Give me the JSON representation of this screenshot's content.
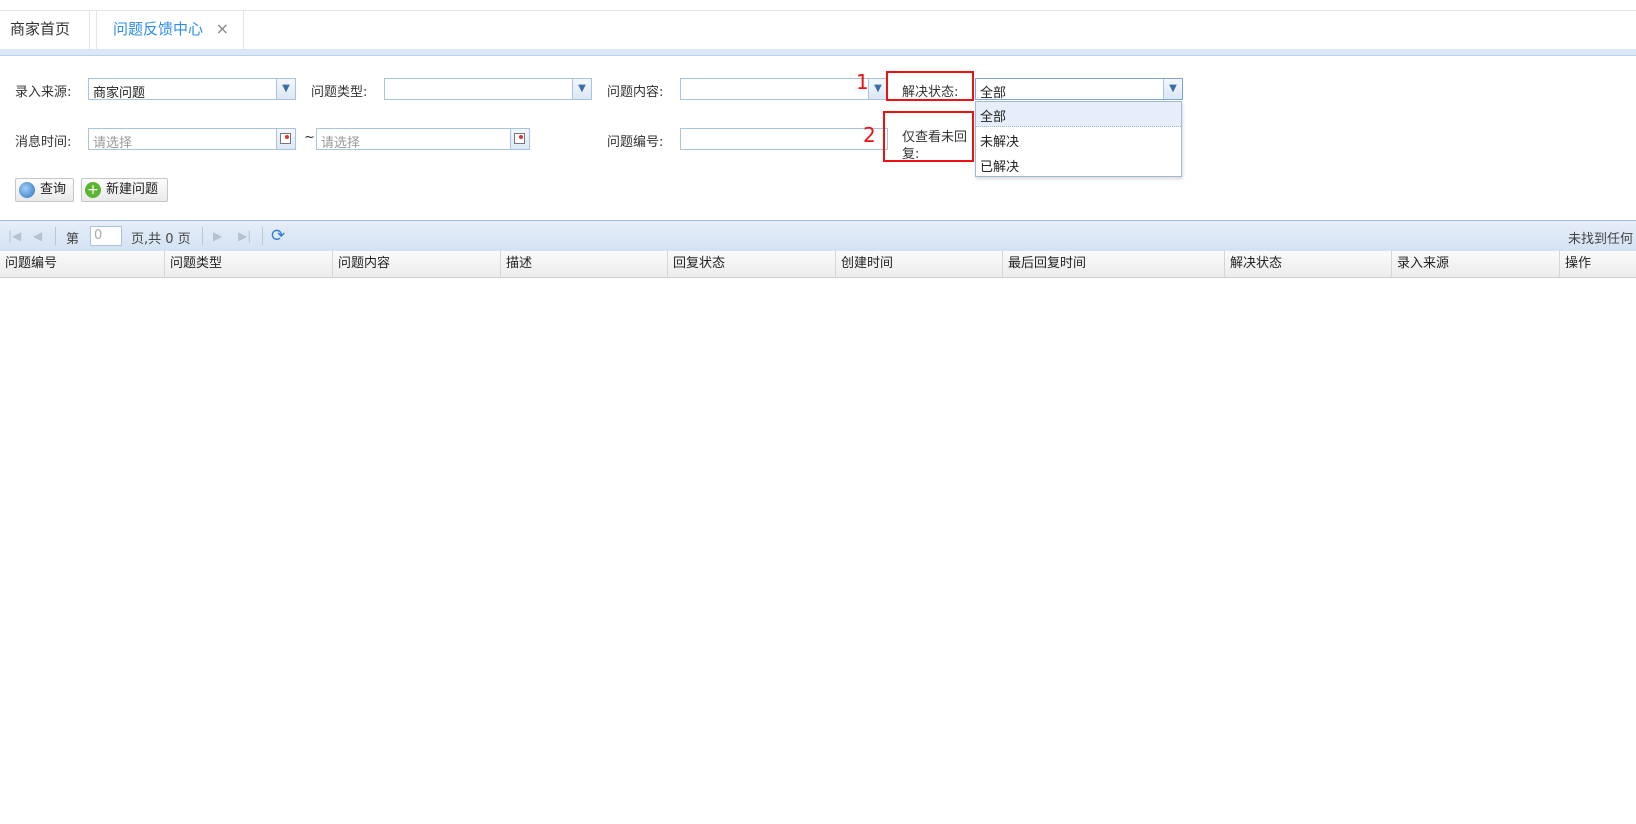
{
  "tabs": {
    "home": "商家首页",
    "active": "问题反馈中心",
    "close_glyph": "×"
  },
  "form": {
    "source_label": "录入来源:",
    "source_value": "商家问题",
    "type_label": "问题类型:",
    "type_value": "",
    "content_label": "问题内容:",
    "content_value": "",
    "status_label": "解决状态:",
    "status_value": "全部",
    "time_label": "消息时间:",
    "time_start_placeholder": "请选择",
    "time_sep": "~",
    "time_end_placeholder": "请选择",
    "number_label": "问题编号:",
    "number_value": "",
    "unreplied_label_line1": "仅查看未回",
    "unreplied_label_line2": "复:"
  },
  "status_options": [
    "全部",
    "未解决",
    "已解决"
  ],
  "annotations": {
    "marker1": "1",
    "marker2": "2",
    "color": "#e11111"
  },
  "buttons": {
    "query": "查询",
    "new_issue": "新建问题"
  },
  "pager": {
    "page_prefix": "第",
    "page_value": "0",
    "page_suffix": "页,共 0 页",
    "status_text": "未找到任何"
  },
  "grid": {
    "columns": [
      "问题编号",
      "问题类型",
      "问题内容",
      "描述",
      "回复状态",
      "创建时间",
      "最后回复时间",
      "解决状态",
      "录入来源",
      "操作"
    ]
  },
  "colors": {
    "accent": "#2d8ce8",
    "border": "#a9c3df"
  }
}
